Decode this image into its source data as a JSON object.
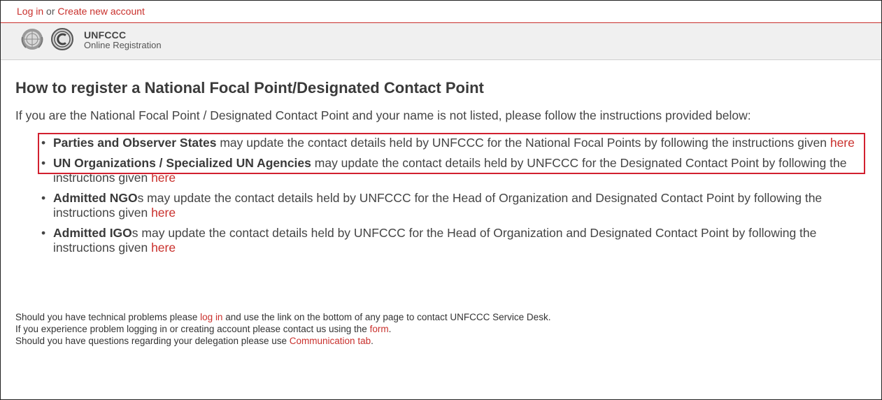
{
  "topbar": {
    "login": "Log in",
    "or": "or",
    "create": "Create new account"
  },
  "brand": {
    "title": "UNFCCC",
    "subtitle": "Online Registration"
  },
  "main": {
    "heading": "How to register a National Focal Point/Designated Contact Point",
    "intro": "If you are the National Focal Point / Designated Contact Point and your name is not listed, please follow the instructions provided below:",
    "items": [
      {
        "bold": "Parties and Observer States",
        "text": " may update the contact details held by UNFCCC for the National Focal Points by following the instructions given ",
        "link": "here"
      },
      {
        "bold": "UN Organizations / Specialized UN Agencies",
        "text": " may update the contact details held by UNFCCC for the Designated Contact Point by following the instructions given ",
        "link": "here"
      },
      {
        "bold": "Admitted NGO",
        "text": "s may update the contact details held by UNFCCC for the Head of Organization and Designated Contact Point by following the instructions given ",
        "link": "here"
      },
      {
        "bold": "Admitted IGO",
        "text": "s may update the contact details held by UNFCCC for the Head of Organization and Designated Contact Point by following the instructions given ",
        "link": "here"
      }
    ]
  },
  "footer": {
    "line1_pre": "Should you have technical problems please ",
    "line1_link": "log in",
    "line1_post": " and use the link on the bottom of any page to contact UNFCCC Service Desk.",
    "line2_pre": "If you experience problem logging in or creating account please contact us using the ",
    "line2_link": "form",
    "line2_post": ".",
    "line3_pre": "Should you have questions regarding your delegation please use ",
    "line3_link": "Communication tab",
    "line3_post": "."
  },
  "colors": {
    "link": "#c9302c",
    "highlight": "#d2202f"
  }
}
